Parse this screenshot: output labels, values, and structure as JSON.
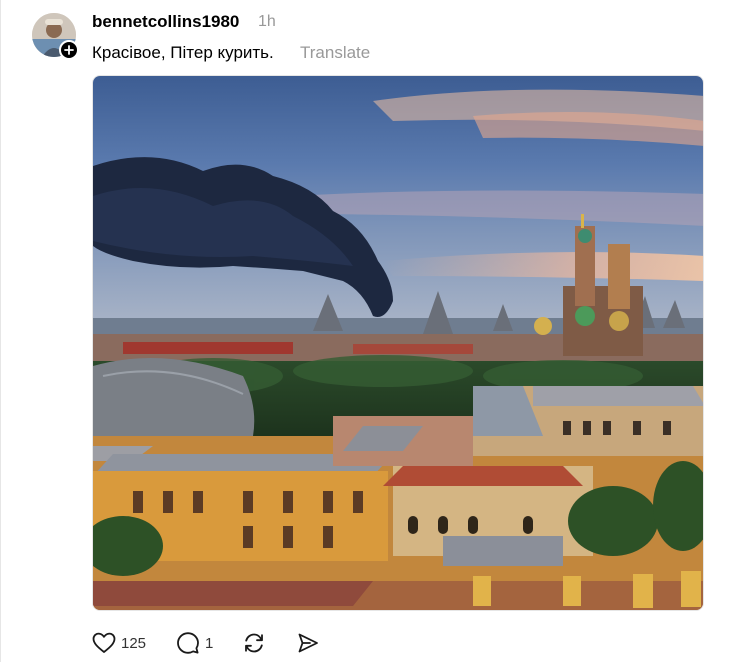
{
  "post": {
    "author": "bennetcollins1980",
    "time": "1h",
    "text": "Красівое, Пітер курить.",
    "translate_label": "Translate",
    "image_alt": "Saint Petersburg skyline with a dark smoke plume and the Church of the Savior on Spilled Blood"
  },
  "actions": {
    "likes": "125",
    "replies": "1"
  },
  "colors": {
    "text": "#000000",
    "secondary": "#999999",
    "icon": "#1a1a1a"
  },
  "icons": [
    "plus-icon",
    "heart-icon",
    "comment-icon",
    "repost-icon",
    "share-icon"
  ]
}
